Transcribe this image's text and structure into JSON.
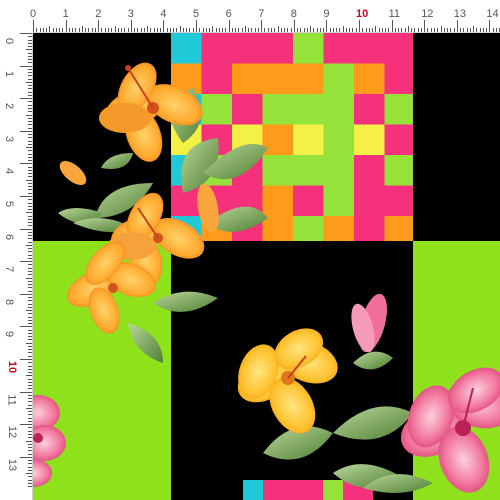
{
  "rulers": {
    "top_labels": [
      "0",
      "1",
      "2",
      "3",
      "4",
      "5",
      "6",
      "7",
      "8",
      "9",
      "10",
      "11",
      "12",
      "13",
      "14"
    ],
    "left_labels": [
      "0",
      "1",
      "2",
      "3",
      "4",
      "5",
      "6",
      "7",
      "8",
      "9",
      "10",
      "11",
      "12",
      "13"
    ],
    "highlight_label": "10"
  },
  "colors": {
    "black": "#000000",
    "lime": "#8fe21b",
    "pink": "#f5317b",
    "orange": "#ff9a1a",
    "cyan": "#1fc9d8",
    "yellow": "#f4f046",
    "green": "#95e23a"
  },
  "icons": [
    "hibiscus-flower-icon",
    "leaf-icon",
    "flower-bud-icon"
  ]
}
